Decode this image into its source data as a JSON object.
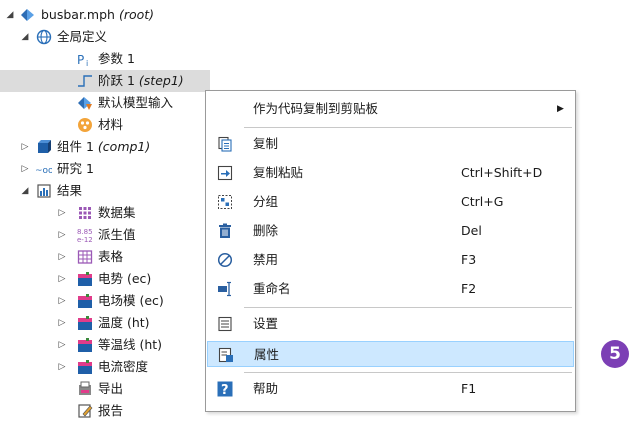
{
  "tree": {
    "root_label": "busbar.mph",
    "root_note": "(root)",
    "global_defs": "全局定义",
    "params": "参数 1",
    "step_label": "阶跃 1",
    "step_note": "(step1)",
    "default_input": "默认模型输入",
    "materials": "材料",
    "component_label": "组件 1",
    "component_note": "(comp1)",
    "study": "研究 1",
    "results": "结果",
    "datasets": "数据集",
    "derived": "派生值",
    "tables": "表格",
    "potential": "电势 (ec)",
    "efield": "电场模 (ec)",
    "temperature": "温度 (ht)",
    "isotherm": "等温线 (ht)",
    "current_density": "电流密度",
    "export": "导出",
    "reports": "报告"
  },
  "menu": {
    "copy_as_code": "作为代码复制到剪贴板",
    "copy": "复制",
    "duplicate": "复制粘贴",
    "duplicate_sc": "Ctrl+Shift+D",
    "group": "分组",
    "group_sc": "Ctrl+G",
    "delete": "删除",
    "delete_sc": "Del",
    "disable": "禁用",
    "disable_sc": "F3",
    "rename": "重命名",
    "rename_sc": "F2",
    "settings": "设置",
    "properties": "属性",
    "help": "帮助",
    "help_sc": "F1"
  },
  "badge": "5",
  "colors": {
    "highlight": "#cde8ff",
    "selected_row": "#dcdcdc",
    "badge": "#7c3fb5"
  }
}
